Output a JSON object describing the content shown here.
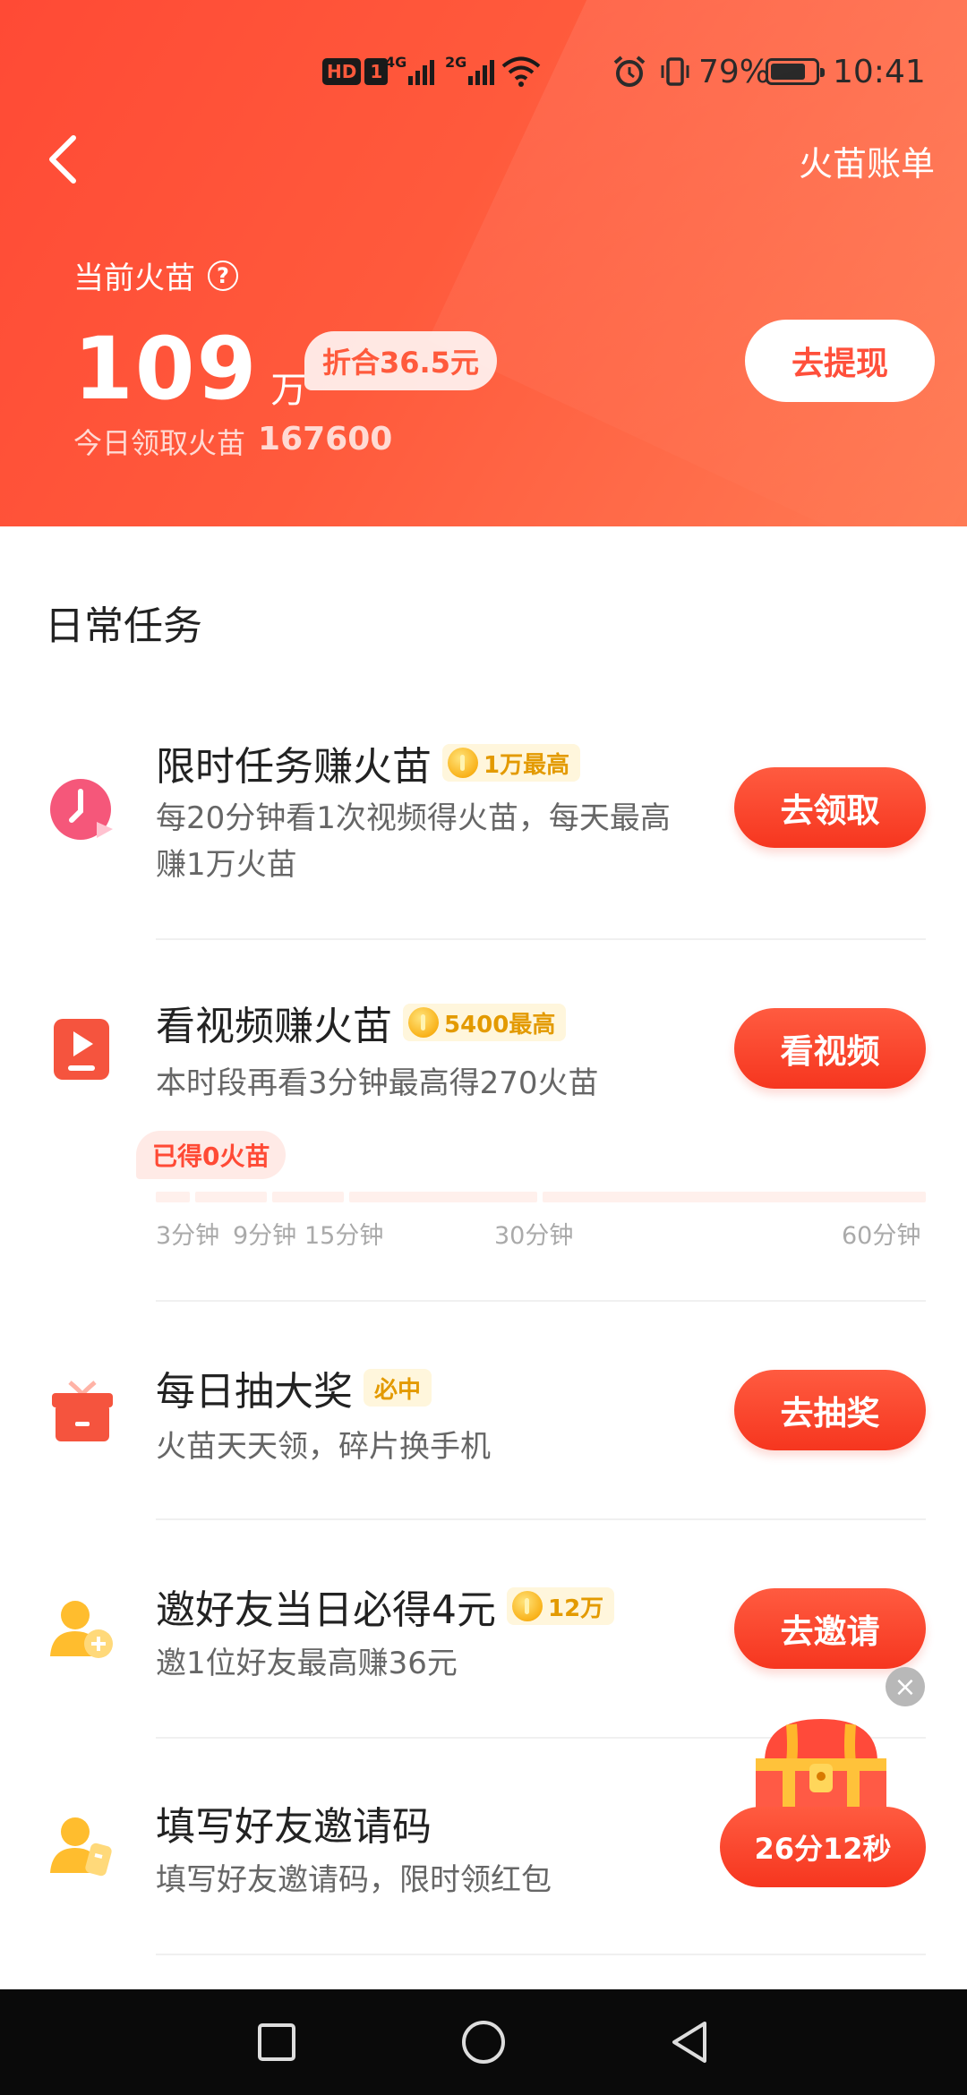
{
  "status_bar": {
    "hd": "HD",
    "sim": "1",
    "net1": "4G",
    "net2": "2G",
    "battery_pct": "79%",
    "time": "10:41"
  },
  "header": {
    "bill_link": "火苗账单",
    "current_label": "当前火苗",
    "balance_number": "109",
    "balance_unit": "万",
    "worth": "折合36.5元",
    "today_label": "今日领取火苗",
    "today_value": "167600",
    "withdraw_button": "去提现"
  },
  "section_title": "日常任务",
  "tasks": [
    {
      "title": "限时任务赚火苗",
      "tag": "1万最高",
      "desc": "每20分钟看1次视频得火苗，每天最高赚1万火苗",
      "button": "去领取"
    },
    {
      "title": "看视频赚火苗",
      "tag": "5400最高",
      "desc": "本时段再看3分钟最高得270火苗",
      "button": "看视频"
    },
    {
      "title": "每日抽大奖",
      "tag": "必中",
      "desc": "火苗天天领，碎片换手机",
      "button": "去抽奖"
    },
    {
      "title": "邀好友当日必得4元",
      "tag": "12万",
      "desc": "邀1位好友最高赚36元",
      "button": "去邀请"
    },
    {
      "title": "填写好友邀请码",
      "desc": "填写好友邀请码，限时领红包"
    }
  ],
  "video_progress": {
    "earned_label": "已得0火苗",
    "ticks": [
      "3分钟",
      "9分钟",
      "15分钟",
      "30分钟",
      "60分钟"
    ]
  },
  "treasure_timer": "26分12秒",
  "icons": {
    "back": "chevron-left-icon",
    "help": "question-icon",
    "task1": "clock-icon",
    "task2": "video-play-icon",
    "task3": "gift-box-icon",
    "task4": "add-user-icon",
    "task5": "user-code-icon"
  },
  "colors": {
    "brand": "#ff4a35",
    "tag_gold": "#e39a00"
  }
}
